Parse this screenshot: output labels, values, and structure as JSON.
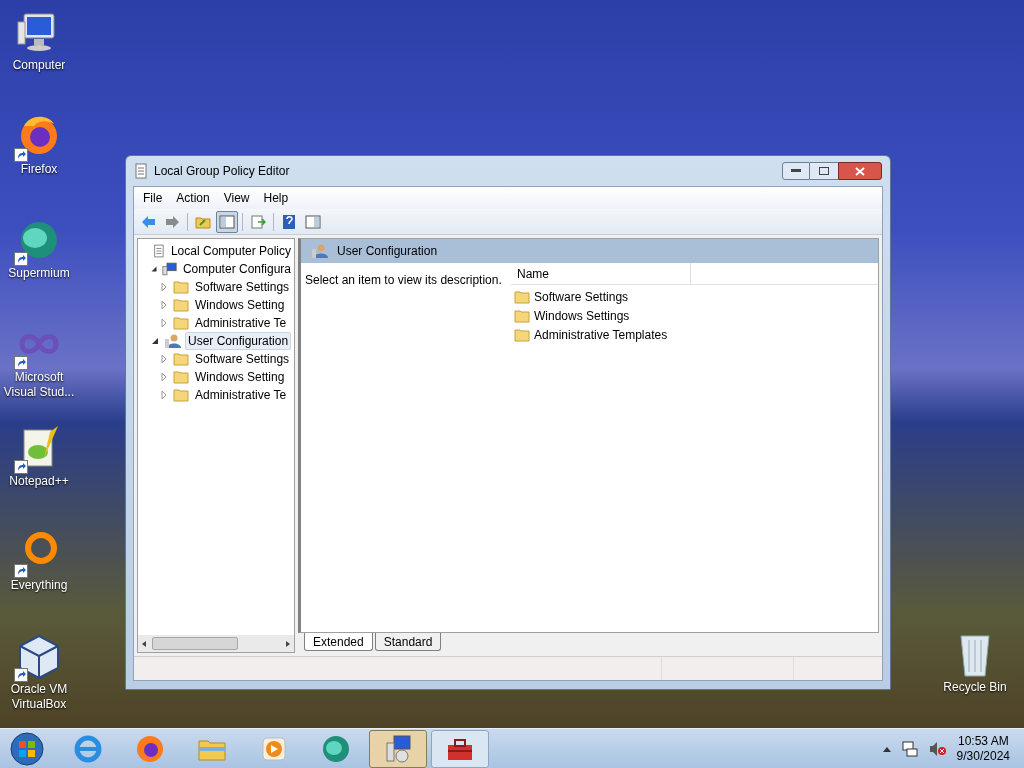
{
  "desktop": {
    "icons": [
      {
        "kind": "computer",
        "label": "Computer",
        "shortcut": false
      },
      {
        "kind": "firefox",
        "label": "Firefox",
        "shortcut": true
      },
      {
        "kind": "supermium",
        "label": "Supermium",
        "shortcut": true
      },
      {
        "kind": "visual-studio",
        "label": "Microsoft Visual Stud...",
        "shortcut": true
      },
      {
        "kind": "notepad",
        "label": "Notepad++",
        "shortcut": true
      },
      {
        "kind": "everything",
        "label": "Everything",
        "shortcut": true
      },
      {
        "kind": "virtualbox",
        "label": "Oracle VM VirtualBox",
        "shortcut": true
      }
    ],
    "recycle_bin": {
      "label": "Recycle Bin"
    }
  },
  "window": {
    "title": "Local Group Policy Editor",
    "menu": [
      "File",
      "Action",
      "View",
      "Help"
    ],
    "toolbar": [
      {
        "kind": "back",
        "pressed": false
      },
      {
        "kind": "forward",
        "pressed": false
      },
      {
        "kind": "separator"
      },
      {
        "kind": "up",
        "pressed": false
      },
      {
        "kind": "tree",
        "pressed": true
      },
      {
        "kind": "separator"
      },
      {
        "kind": "export",
        "pressed": false
      },
      {
        "kind": "separator"
      },
      {
        "kind": "help",
        "pressed": false
      },
      {
        "kind": "pane",
        "pressed": false
      }
    ],
    "tree": [
      {
        "kind": "policy",
        "label": "Local Computer Policy",
        "selected": false,
        "children": [
          {
            "kind": "computer",
            "label": "Computer Configura",
            "selected": false,
            "expanded": true,
            "children": [
              {
                "kind": "folder",
                "label": "Software Settings",
                "selected": false,
                "expanded": false
              },
              {
                "kind": "folder",
                "label": "Windows Setting",
                "selected": false,
                "expanded": false
              },
              {
                "kind": "folder",
                "label": "Administrative Te",
                "selected": false,
                "expanded": false
              }
            ]
          },
          {
            "kind": "user",
            "label": "User Configuration",
            "selected": true,
            "expanded": true,
            "children": [
              {
                "kind": "folder",
                "label": "Software Settings",
                "selected": false,
                "expanded": false
              },
              {
                "kind": "folder",
                "label": "Windows Setting",
                "selected": false,
                "expanded": false
              },
              {
                "kind": "folder",
                "label": "Administrative Te",
                "selected": false,
                "expanded": false
              }
            ]
          }
        ]
      }
    ],
    "details": {
      "title": "User Configuration",
      "description": "Select an item to view its description.",
      "columns": [
        "Name"
      ],
      "items": [
        "Software Settings",
        "Windows Settings",
        "Administrative Templates"
      ]
    },
    "tabs": [
      {
        "label": "Extended",
        "selected": true
      },
      {
        "label": "Standard",
        "selected": false
      }
    ]
  },
  "taskbar": {
    "buttons": [
      {
        "kind": "internet-explorer",
        "active": false
      },
      {
        "kind": "firefox",
        "active": false
      },
      {
        "kind": "explorer",
        "active": false
      },
      {
        "kind": "media-player",
        "active": false
      },
      {
        "kind": "supermium",
        "active": false
      },
      {
        "kind": "policy-editor",
        "active": true
      },
      {
        "kind": "toolbox",
        "active": false
      }
    ],
    "time": "10:53 AM",
    "date": "9/30/2024"
  }
}
